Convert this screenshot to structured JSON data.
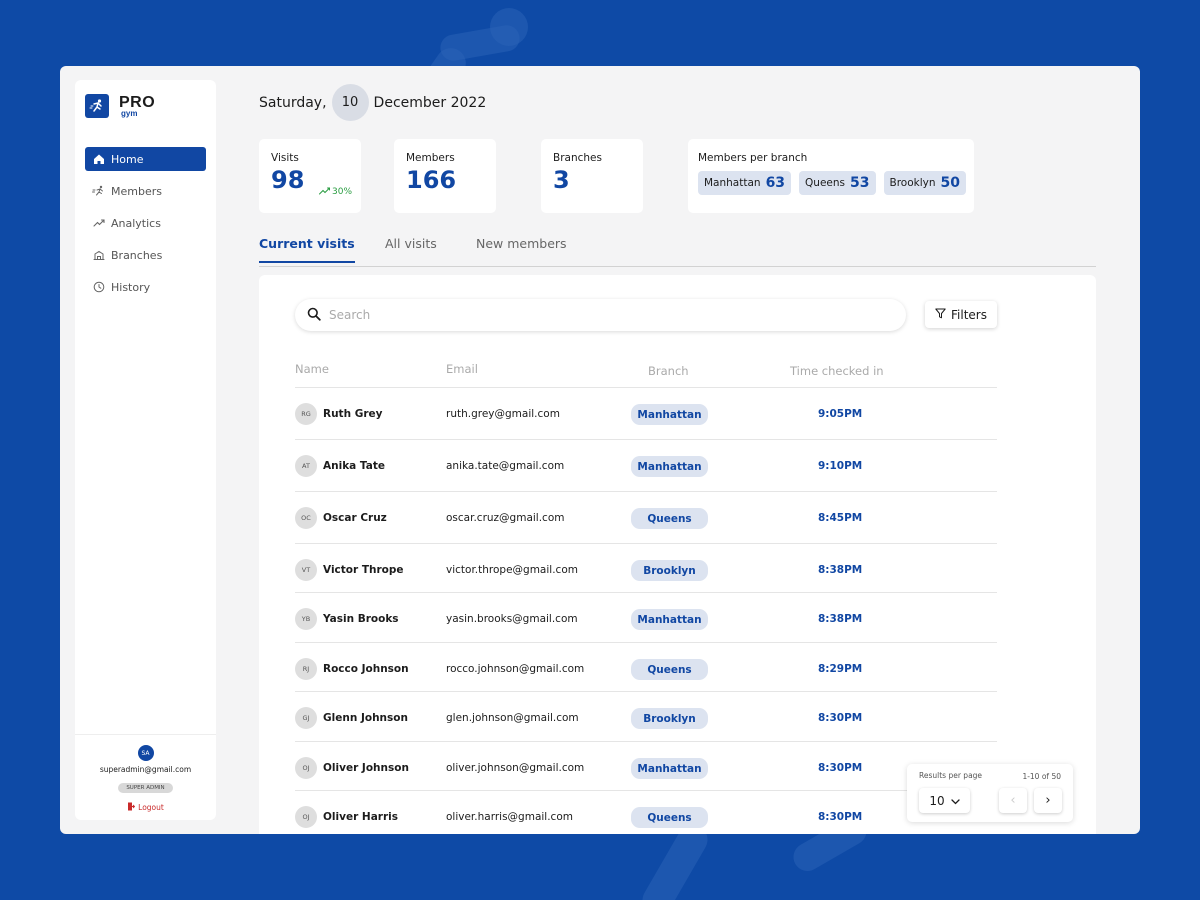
{
  "app": {
    "logo_main": "PRO",
    "logo_sub": "gym"
  },
  "sidebar": {
    "items": [
      {
        "label": "Home",
        "icon": "home-icon",
        "active": true
      },
      {
        "label": "Members",
        "icon": "runner-icon",
        "active": false
      },
      {
        "label": "Analytics",
        "icon": "trend-icon",
        "active": false
      },
      {
        "label": "Branches",
        "icon": "building-icon",
        "active": false
      },
      {
        "label": "History",
        "icon": "clock-icon",
        "active": false
      }
    ],
    "user": {
      "initials": "SA",
      "email": "superadmin@gmail.com",
      "role": "SUPER ADMIN",
      "logout": "Logout"
    }
  },
  "header": {
    "weekday": "Saturday,",
    "day": "10",
    "month_year": "December 2022"
  },
  "stats": {
    "visits": {
      "label": "Visits",
      "value": "98",
      "trend": "30%"
    },
    "members": {
      "label": "Members",
      "value": "166"
    },
    "branches": {
      "label": "Branches",
      "value": "3"
    },
    "per_branch": {
      "label": "Members per branch",
      "items": [
        {
          "name": "Manhattan",
          "count": "63"
        },
        {
          "name": "Queens",
          "count": "53"
        },
        {
          "name": "Brooklyn",
          "count": "50"
        }
      ]
    }
  },
  "tabs": [
    {
      "label": "Current visits",
      "active": true
    },
    {
      "label": "All visits",
      "active": false
    },
    {
      "label": "New members",
      "active": false
    }
  ],
  "table": {
    "search_placeholder": "Search",
    "filters_label": "Filters",
    "columns": {
      "name": "Name",
      "email": "Email",
      "branch": "Branch",
      "time": "Time checked in"
    },
    "rows": [
      {
        "initials": "RG",
        "name": "Ruth Grey",
        "email": "ruth.grey@gmail.com",
        "branch": "Manhattan",
        "time": "9:05PM"
      },
      {
        "initials": "AT",
        "name": "Anika Tate",
        "email": "anika.tate@gmail.com",
        "branch": "Manhattan",
        "time": "9:10PM"
      },
      {
        "initials": "OC",
        "name": "Oscar Cruz",
        "email": "oscar.cruz@gmail.com",
        "branch": "Queens",
        "time": "8:45PM"
      },
      {
        "initials": "VT",
        "name": "Victor Thrope",
        "email": "victor.thrope@gmail.com",
        "branch": "Brooklyn",
        "time": "8:38PM"
      },
      {
        "initials": "YB",
        "name": "Yasin Brooks",
        "email": "yasin.brooks@gmail.com",
        "branch": "Manhattan",
        "time": "8:38PM"
      },
      {
        "initials": "RJ",
        "name": "Rocco Johnson",
        "email": "rocco.johnson@gmail.com",
        "branch": "Queens",
        "time": "8:29PM"
      },
      {
        "initials": "GJ",
        "name": "Glenn Johnson",
        "email": "glen.johnson@gmail.com",
        "branch": "Brooklyn",
        "time": "8:30PM"
      },
      {
        "initials": "OJ",
        "name": "Oliver Johnson",
        "email": "oliver.johnson@gmail.com",
        "branch": "Manhattan",
        "time": "8:30PM"
      },
      {
        "initials": "OJ",
        "name": "Oliver Harris",
        "email": "oliver.harris@gmail.com",
        "branch": "Queens",
        "time": "8:30PM"
      }
    ]
  },
  "pagination": {
    "label": "Results per page",
    "per_page": "10",
    "range": "1-10 of 50",
    "prev": "‹",
    "next": "›"
  },
  "colors": {
    "primary": "#1147a3",
    "background": "#0e4aa6",
    "pill": "#dce3f0",
    "trend_up": "#2a9d42",
    "logout": "#c92a2a"
  }
}
